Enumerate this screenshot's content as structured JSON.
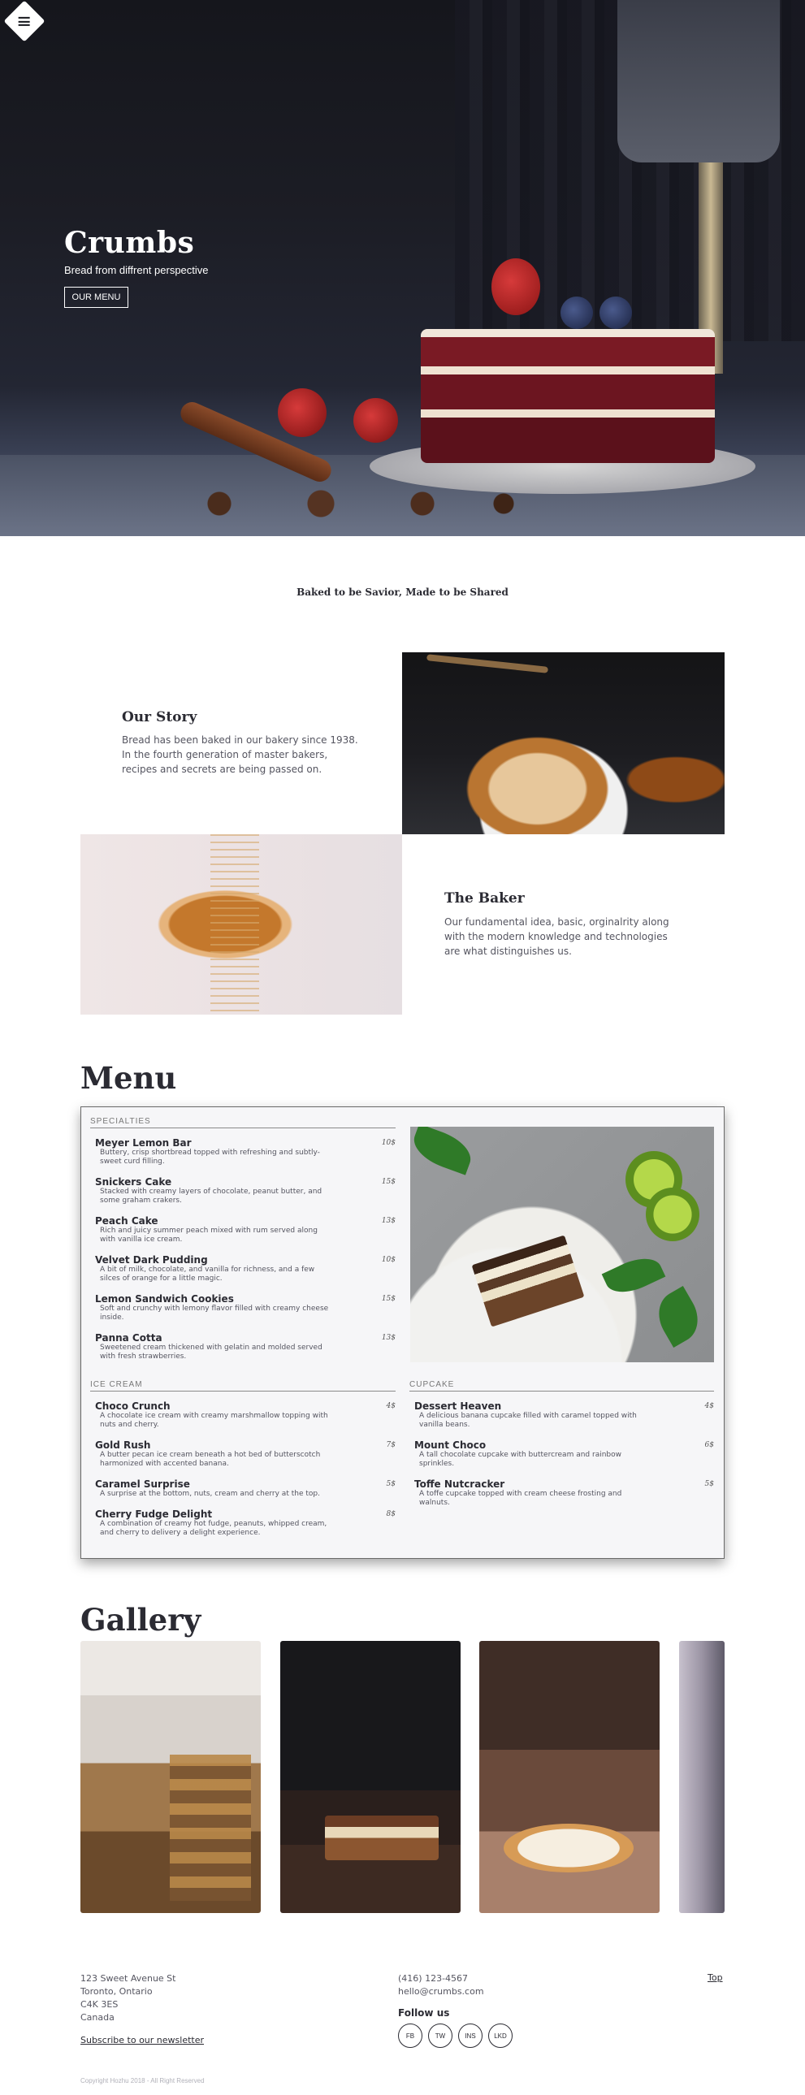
{
  "hero": {
    "title": "Crumbs",
    "subtitle": "Bread from diffrent perspective",
    "button_label": "OUR MENU"
  },
  "tagline": "Baked to be Savior, Made to be Shared",
  "story": {
    "title": "Our Story",
    "text": "Bread has been baked in our bakery since 1938. In the fourth generation of master bakers, recipes and secrets are being passed on."
  },
  "baker": {
    "title": "The Baker",
    "text": "Our fundamental idea, basic, orginalrity along with the modern knowledge and technologies are what distinguishes us."
  },
  "menu": {
    "title": "Menu",
    "sections": [
      {
        "heading": "SPECIALTIES",
        "items": [
          {
            "name": "Meyer Lemon Bar",
            "desc": "Buttery, crisp shortbread topped with refreshing and subtly-sweet curd filling.",
            "price": "10$"
          },
          {
            "name": "Snickers Cake",
            "desc": "Stacked with creamy layers of chocolate, peanut butter, and some graham crakers.",
            "price": "15$"
          },
          {
            "name": "Peach Cake",
            "desc": "Rich and juicy summer peach mixed with rum served along with vanilla ice cream.",
            "price": "13$"
          },
          {
            "name": "Velvet Dark Pudding",
            "desc": "A bit of milk, chocolate, and vanilla for richness, and a few silces of orange for a little magic.",
            "price": "10$"
          },
          {
            "name": "Lemon Sandwich Cookies",
            "desc": "Soft and crunchy with lemony flavor filled with creamy cheese inside.",
            "price": "15$"
          },
          {
            "name": "Panna Cotta",
            "desc": "Sweetened cream thickened with gelatin and molded served with fresh strawberries.",
            "price": "13$"
          }
        ]
      },
      {
        "heading": "ICE CREAM",
        "items": [
          {
            "name": "Choco Crunch",
            "desc": "A chocolate ice cream with creamy marshmallow topping with nuts and cherry.",
            "price": "4$"
          },
          {
            "name": "Gold Rush",
            "desc": "A butter pecan ice cream beneath a hot bed of butterscotch harmonized with accented banana.",
            "price": "7$"
          },
          {
            "name": "Caramel Surprise",
            "desc": "A surprise at the bottom, nuts, cream and cherry at the top.",
            "price": "5$"
          },
          {
            "name": "Cherry Fudge Delight",
            "desc": "A combination of creamy hot fudge, peanuts, whipped cream, and cherry to delivery a delight experience.",
            "price": "8$"
          }
        ]
      },
      {
        "heading": "CUPCAKE",
        "items": [
          {
            "name": "Dessert Heaven",
            "desc": "A delicious banana cupcake filled with caramel topped with vanilla beans.",
            "price": "4$"
          },
          {
            "name": "Mount Choco",
            "desc": "A tall chocolate cupcake with buttercream and rainbow sprinkles.",
            "price": "6$"
          },
          {
            "name": "Toffe Nutcracker",
            "desc": "A toffe cupcake topped with cream cheese frosting and walnuts.",
            "price": "5$"
          }
        ]
      }
    ]
  },
  "gallery": {
    "title": "Gallery"
  },
  "footer": {
    "address": [
      "123 Sweet Avenue St",
      "Toronto, Ontario",
      "C4K 3ES",
      "Canada"
    ],
    "newsletter_link": "Subscribe to our newsletter",
    "phone": "(416) 123-4567",
    "email": "hello@crumbs.com",
    "follow_label": "Follow us",
    "socials": [
      "FB",
      "TW",
      "INS",
      "LKD"
    ],
    "top_link": "Top",
    "copyright": "Copyright Hozhu 2018 - All Right Reserved"
  },
  "icons": {
    "menu_toggle": "hamburger-icon"
  }
}
